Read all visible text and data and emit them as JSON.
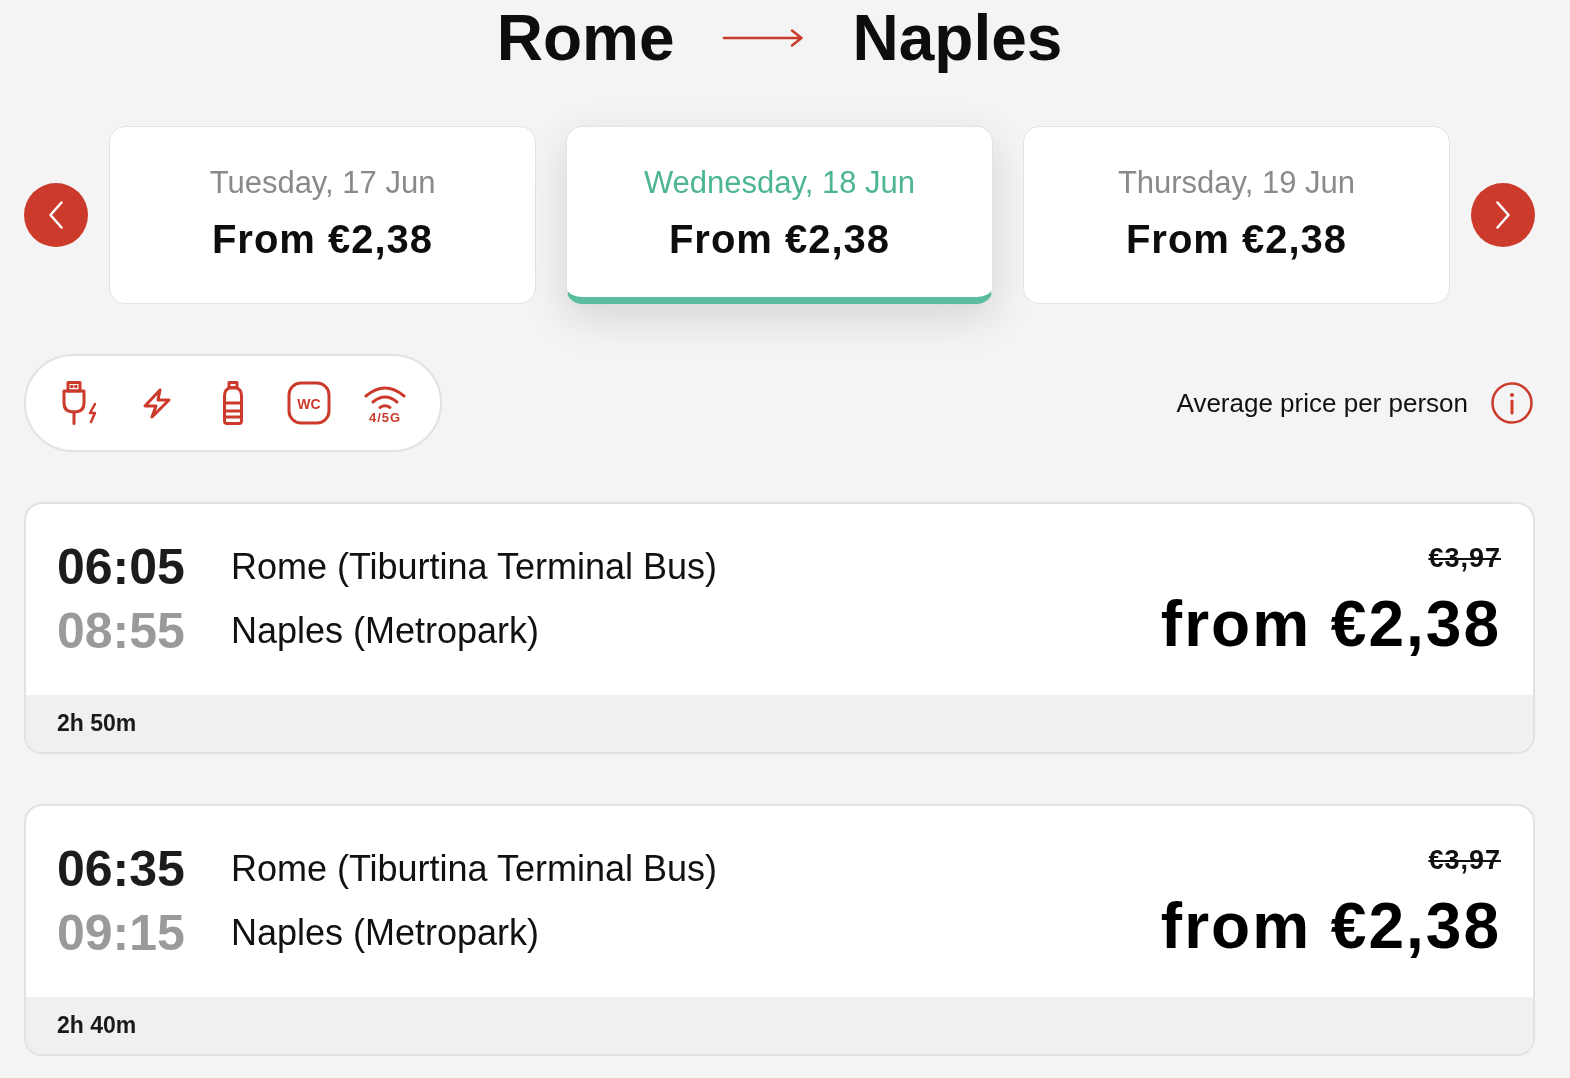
{
  "route": {
    "origin": "Rome",
    "destination": "Naples"
  },
  "dates": [
    {
      "label": "Tuesday, 17 Jun",
      "price": "From €2,38",
      "selected": false
    },
    {
      "label": "Wednesday, 18 Jun",
      "price": "From €2,38",
      "selected": true
    },
    {
      "label": "Thursday, 19 Jun",
      "price": "From €2,38",
      "selected": false
    }
  ],
  "amenities": [
    {
      "kind": "usb-charging"
    },
    {
      "kind": "power"
    },
    {
      "kind": "water"
    },
    {
      "kind": "wc",
      "label": "WC"
    },
    {
      "kind": "wifi",
      "label": "4/5G"
    }
  ],
  "price_note": "Average price per person",
  "trips": [
    {
      "departure": "06:05",
      "arrival": "08:55",
      "origin_stop": "Rome (Tiburtina Terminal Bus)",
      "destination_stop": "Naples (Metropark)",
      "old_price": "€3,97",
      "price": "from €2,38",
      "duration": "2h 50m"
    },
    {
      "departure": "06:35",
      "arrival": "09:15",
      "origin_stop": "Rome (Tiburtina Terminal Bus)",
      "destination_stop": "Naples (Metropark)",
      "old_price": "€3,97",
      "price": "from €2,38",
      "duration": "2h 40m"
    }
  ]
}
